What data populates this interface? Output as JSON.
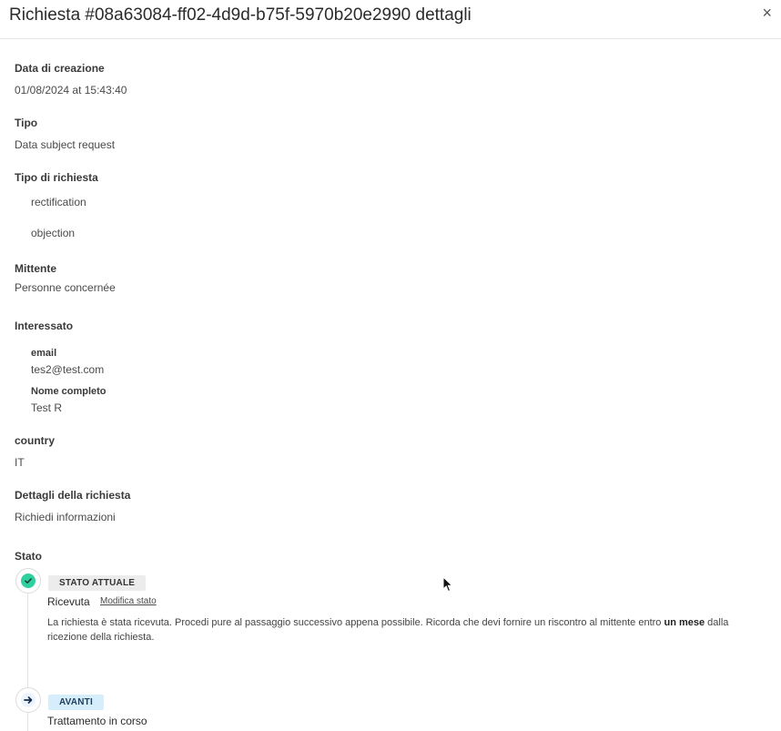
{
  "header": {
    "title": "Richiesta #08a63084-ff02-4d9d-b75f-5970b20e2990 dettagli",
    "close_glyph": "×"
  },
  "fields": {
    "creation_date": {
      "label": "Data di creazione",
      "value": "01/08/2024 at 15:43:40"
    },
    "type": {
      "label": "Tipo",
      "value": "Data subject request"
    },
    "request_type": {
      "label": "Tipo di richiesta",
      "items": [
        "rectification",
        "objection"
      ]
    },
    "sender": {
      "label": "Mittente",
      "value": "Personne concernée"
    },
    "data_subject": {
      "label": "Interessato",
      "email": {
        "label": "email",
        "value": "tes2@test.com"
      },
      "full_name": {
        "label": "Nome completo",
        "value": "Test R"
      }
    },
    "country": {
      "label": "country",
      "value": "IT"
    },
    "details": {
      "label": "Dettagli della richiesta",
      "value": "Richiedi informazioni"
    }
  },
  "status": {
    "label": "Stato",
    "current": {
      "badge": "STATO ATTUALE",
      "name": "Ricevuta",
      "edit_link": "Modifica stato",
      "description_before": "La richiesta è stata ricevuta. Procedi pure al passaggio successivo appena possibile. Ricorda che devi fornire un riscontro al mittente entro ",
      "description_bold": "un mese",
      "description_after": " dalla ricezione della richiesta."
    },
    "next": {
      "badge": "AVANTI",
      "name": "Trattamento in corso"
    }
  },
  "colors": {
    "current_badge_bg": "#ececec",
    "next_badge_bg": "#d6eefc",
    "check_bg": "#2fcf9f",
    "next_icon_bg": "#e9f4ff"
  },
  "icons": {
    "current": "check-icon",
    "next": "arrow-right-icon",
    "close": "close-icon"
  }
}
